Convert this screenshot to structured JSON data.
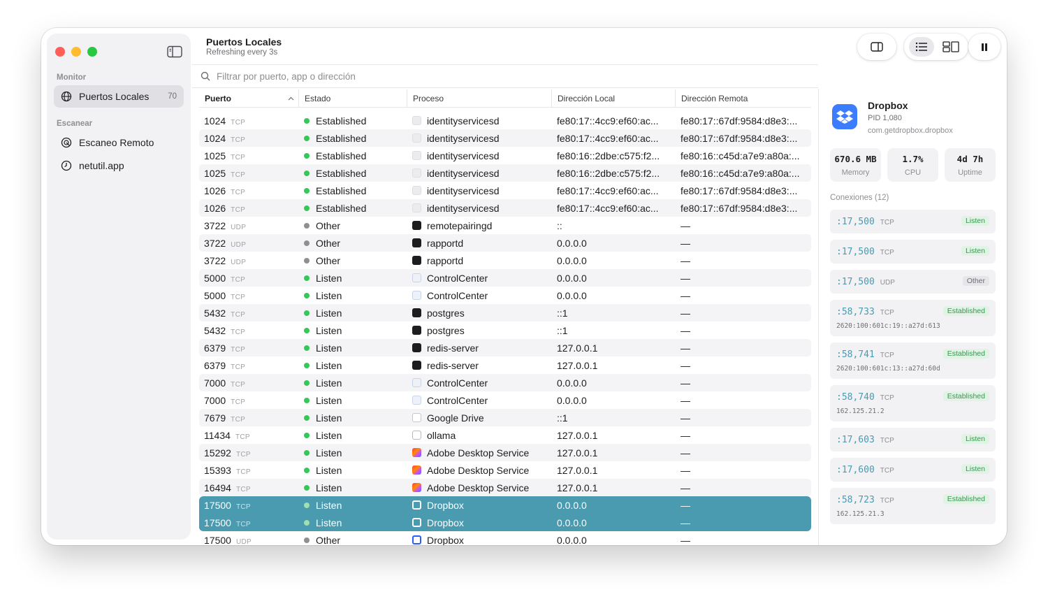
{
  "sidebar": {
    "section_monitor": "Monitor",
    "section_scan": "Escanear",
    "items": [
      {
        "label": "Puertos Locales",
        "count": "70",
        "icon": "network-icon"
      },
      {
        "label": "Escaneo Remoto",
        "icon": "radar-icon"
      },
      {
        "label": "netutil.app",
        "icon": "clock-icon"
      }
    ]
  },
  "header": {
    "title": "Puertos Locales",
    "subtitle": "Refreshing every 3s"
  },
  "search": {
    "placeholder": "Filtrar por puerto, app o dirección"
  },
  "table": {
    "columns": [
      "Puerto",
      "Estado",
      "Proceso",
      "Dirección Local",
      "Dirección Remota"
    ],
    "rows": [
      {
        "port": "1024",
        "proto": "TCP",
        "state": "Established",
        "process": "identityservicesd",
        "local": "fe80:17::4cc9:ef60:ac...",
        "remote": "fe80:17::67df:9584:d8e3:..."
      },
      {
        "port": "1024",
        "proto": "TCP",
        "state": "Established",
        "process": "identityservicesd",
        "local": "fe80:17::4cc9:ef60:ac...",
        "remote": "fe80:17::67df:9584:d8e3:..."
      },
      {
        "port": "1025",
        "proto": "TCP",
        "state": "Established",
        "process": "identityservicesd",
        "local": "fe80:16::2dbe:c575:f2...",
        "remote": "fe80:16::c45d:a7e9:a80a:..."
      },
      {
        "port": "1025",
        "proto": "TCP",
        "state": "Established",
        "process": "identityservicesd",
        "local": "fe80:16::2dbe:c575:f2...",
        "remote": "fe80:16::c45d:a7e9:a80a:..."
      },
      {
        "port": "1026",
        "proto": "TCP",
        "state": "Established",
        "process": "identityservicesd",
        "local": "fe80:17::4cc9:ef60:ac...",
        "remote": "fe80:17::67df:9584:d8e3:..."
      },
      {
        "port": "1026",
        "proto": "TCP",
        "state": "Established",
        "process": "identityservicesd",
        "local": "fe80:17::4cc9:ef60:ac...",
        "remote": "fe80:17::67df:9584:d8e3:..."
      },
      {
        "port": "3722",
        "proto": "UDP",
        "state": "Other",
        "process": "remotepairingd",
        "local": "::",
        "remote": "—"
      },
      {
        "port": "3722",
        "proto": "UDP",
        "state": "Other",
        "process": "rapportd",
        "local": "0.0.0.0",
        "remote": "—"
      },
      {
        "port": "3722",
        "proto": "UDP",
        "state": "Other",
        "process": "rapportd",
        "local": "0.0.0.0",
        "remote": "—"
      },
      {
        "port": "5000",
        "proto": "TCP",
        "state": "Listen",
        "process": "ControlCenter",
        "local": "0.0.0.0",
        "remote": "—"
      },
      {
        "port": "5000",
        "proto": "TCP",
        "state": "Listen",
        "process": "ControlCenter",
        "local": "0.0.0.0",
        "remote": "—"
      },
      {
        "port": "5432",
        "proto": "TCP",
        "state": "Listen",
        "process": "postgres",
        "local": "::1",
        "remote": "—"
      },
      {
        "port": "5432",
        "proto": "TCP",
        "state": "Listen",
        "process": "postgres",
        "local": "::1",
        "remote": "—"
      },
      {
        "port": "6379",
        "proto": "TCP",
        "state": "Listen",
        "process": "redis-server",
        "local": "127.0.0.1",
        "remote": "—"
      },
      {
        "port": "6379",
        "proto": "TCP",
        "state": "Listen",
        "process": "redis-server",
        "local": "127.0.0.1",
        "remote": "—"
      },
      {
        "port": "7000",
        "proto": "TCP",
        "state": "Listen",
        "process": "ControlCenter",
        "local": "0.0.0.0",
        "remote": "—"
      },
      {
        "port": "7000",
        "proto": "TCP",
        "state": "Listen",
        "process": "ControlCenter",
        "local": "0.0.0.0",
        "remote": "—"
      },
      {
        "port": "7679",
        "proto": "TCP",
        "state": "Listen",
        "process": "Google Drive",
        "local": "::1",
        "remote": "—"
      },
      {
        "port": "11434",
        "proto": "TCP",
        "state": "Listen",
        "process": "ollama",
        "local": "127.0.0.1",
        "remote": "—"
      },
      {
        "port": "15292",
        "proto": "TCP",
        "state": "Listen",
        "process": "Adobe Desktop Service",
        "local": "127.0.0.1",
        "remote": "—"
      },
      {
        "port": "15393",
        "proto": "TCP",
        "state": "Listen",
        "process": "Adobe Desktop Service",
        "local": "127.0.0.1",
        "remote": "—"
      },
      {
        "port": "16494",
        "proto": "TCP",
        "state": "Listen",
        "process": "Adobe Desktop Service",
        "local": "127.0.0.1",
        "remote": "—"
      },
      {
        "port": "17500",
        "proto": "TCP",
        "state": "Listen",
        "process": "Dropbox",
        "local": "0.0.0.0",
        "remote": "—",
        "selected": true
      },
      {
        "port": "17500",
        "proto": "TCP",
        "state": "Listen",
        "process": "Dropbox",
        "local": "0.0.0.0",
        "remote": "—",
        "selected": true
      },
      {
        "port": "17500",
        "proto": "UDP",
        "state": "Other",
        "process": "Dropbox",
        "local": "0.0.0.0",
        "remote": "—"
      }
    ]
  },
  "process_icons": {
    "identityservicesd": "blank",
    "remotepairingd": "dark",
    "rapportd": "dark",
    "ControlCenter": "cc",
    "postgres": "dark",
    "redis-server": "dark",
    "Google Drive": "drive",
    "ollama": "ollama",
    "Adobe Desktop Service": "adobe",
    "Dropbox": "dropbox"
  },
  "state_colors": {
    "Established": "#34c759",
    "Listen": "#34c759",
    "Other": "#8e8e93"
  },
  "detail": {
    "app_name": "Dropbox",
    "pid": "PID 1,080",
    "bundle": "com.getdropbox.dropbox",
    "stats": [
      {
        "value": "670.6 MB",
        "label": "Memory"
      },
      {
        "value": "1.7%",
        "label": "CPU"
      },
      {
        "value": "4d 7h",
        "label": "Uptime"
      }
    ],
    "connections_label": "Conexiones (12)",
    "connections": [
      {
        "port": ":17,500",
        "proto": "TCP",
        "state": "Listen",
        "remote": ""
      },
      {
        "port": ":17,500",
        "proto": "TCP",
        "state": "Listen",
        "remote": ""
      },
      {
        "port": ":17,500",
        "proto": "UDP",
        "state": "Other",
        "remote": ""
      },
      {
        "port": ":58,733",
        "proto": "TCP",
        "state": "Established",
        "remote": "2620:100:601c:19::a27d:613"
      },
      {
        "port": ":58,741",
        "proto": "TCP",
        "state": "Established",
        "remote": "2620:100:601c:13::a27d:60d"
      },
      {
        "port": ":58,740",
        "proto": "TCP",
        "state": "Established",
        "remote": "162.125.21.2"
      },
      {
        "port": ":17,603",
        "proto": "TCP",
        "state": "Listen",
        "remote": ""
      },
      {
        "port": ":17,600",
        "proto": "TCP",
        "state": "Listen",
        "remote": ""
      },
      {
        "port": ":58,723",
        "proto": "TCP",
        "state": "Established",
        "remote": "162.125.21.3"
      }
    ]
  },
  "colors": {
    "accent": "#4a9ab0",
    "dropbox": "#3c7cff"
  }
}
